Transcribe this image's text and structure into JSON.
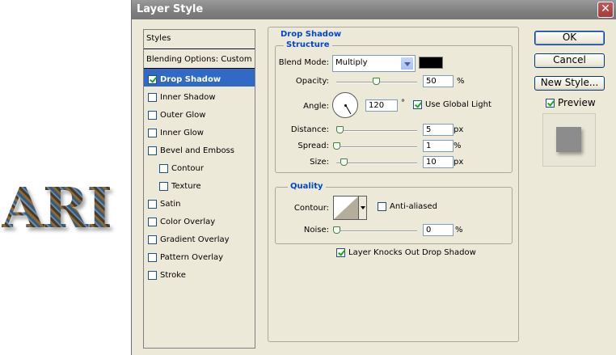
{
  "canvas": {
    "art_text": "ARI"
  },
  "window": {
    "title": "Layer Style",
    "close_glyph": "✕"
  },
  "styles": {
    "header": "Styles",
    "blending": "Blending Options: Custom",
    "items": [
      {
        "label": "Drop Shadow",
        "checked": true,
        "selected": true,
        "sub": false
      },
      {
        "label": "Inner Shadow",
        "checked": false,
        "selected": false,
        "sub": false
      },
      {
        "label": "Outer Glow",
        "checked": false,
        "selected": false,
        "sub": false
      },
      {
        "label": "Inner Glow",
        "checked": false,
        "selected": false,
        "sub": false
      },
      {
        "label": "Bevel and Emboss",
        "checked": false,
        "selected": false,
        "sub": false
      },
      {
        "label": "Contour",
        "checked": false,
        "selected": false,
        "sub": true
      },
      {
        "label": "Texture",
        "checked": false,
        "selected": false,
        "sub": true
      },
      {
        "label": "Satin",
        "checked": false,
        "selected": false,
        "sub": false
      },
      {
        "label": "Color Overlay",
        "checked": false,
        "selected": false,
        "sub": false
      },
      {
        "label": "Gradient Overlay",
        "checked": false,
        "selected": false,
        "sub": false
      },
      {
        "label": "Pattern Overlay",
        "checked": false,
        "selected": false,
        "sub": false
      },
      {
        "label": "Stroke",
        "checked": false,
        "selected": false,
        "sub": false
      }
    ]
  },
  "drop_shadow": {
    "title": "Drop Shadow",
    "structure": {
      "title": "Structure",
      "blend_mode_label": "Blend Mode:",
      "blend_mode_value": "Multiply",
      "shadow_color": "#000000",
      "opacity_label": "Opacity:",
      "opacity_value": "50",
      "opacity_unit": "%",
      "angle_label": "Angle:",
      "angle_value": "120",
      "angle_unit": "°",
      "use_global_light_label": "Use Global Light",
      "use_global_light_checked": true,
      "distance_label": "Distance:",
      "distance_value": "5",
      "distance_unit": "px",
      "spread_label": "Spread:",
      "spread_value": "1",
      "spread_unit": "%",
      "size_label": "Size:",
      "size_value": "10",
      "size_unit": "px"
    },
    "quality": {
      "title": "Quality",
      "contour_label": "Contour:",
      "anti_aliased_label": "Anti-aliased",
      "anti_aliased_checked": false,
      "noise_label": "Noise:",
      "noise_value": "0",
      "noise_unit": "%"
    },
    "knockout_label": "Layer Knocks Out Drop Shadow",
    "knockout_checked": true
  },
  "buttons": {
    "ok": "OK",
    "cancel": "Cancel",
    "new_style": "New Style...",
    "preview_label": "Preview",
    "preview_checked": true
  }
}
